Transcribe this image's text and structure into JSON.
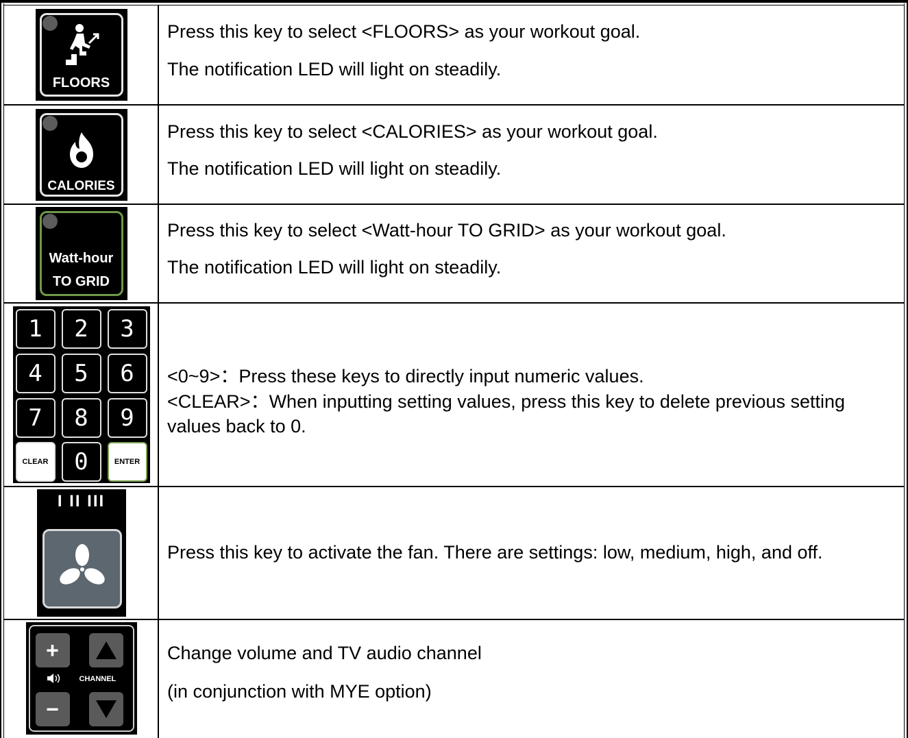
{
  "rows": [
    {
      "icon": {
        "label": "FLOORS",
        "type": "floors-key"
      },
      "lines": [
        "Press this key to select <FLOORS> as your workout goal.",
        "The notification LED will light on steadily."
      ]
    },
    {
      "icon": {
        "label": "CALORIES",
        "type": "calories-key"
      },
      "lines": [
        "Press this key to select <CALORIES> as your workout goal.",
        "The notification LED will light on steadily."
      ]
    },
    {
      "icon": {
        "label_line1": "Watt-hour",
        "label_line2": "TO GRID",
        "type": "watt-hour-key"
      },
      "lines": [
        "Press this key to select <Watt-hour TO GRID> as your workout goal.",
        "The notification LED will light on steadily."
      ]
    },
    {
      "icon": {
        "type": "numeric-keypad",
        "keys": [
          "1",
          "2",
          "3",
          "4",
          "5",
          "6",
          "7",
          "8",
          "9",
          "CLEAR",
          "0",
          "ENTER"
        ]
      },
      "lines": [
        "<0~9>：Press these keys to directly input numeric values.",
        "<CLEAR>：When inputting setting values, press this key to delete previous setting values back to 0."
      ]
    },
    {
      "icon": {
        "type": "fan-key",
        "levels": "I II III"
      },
      "lines": [
        "Press this key to activate the fan. There are settings: low, medium, high, and off."
      ]
    },
    {
      "icon": {
        "type": "volume-channel-keys",
        "channel_label": "CHANNEL",
        "plus": "+",
        "minus": "−"
      },
      "lines": [
        "Change volume and TV audio channel",
        "(in conjunction with MYE option)"
      ]
    }
  ]
}
